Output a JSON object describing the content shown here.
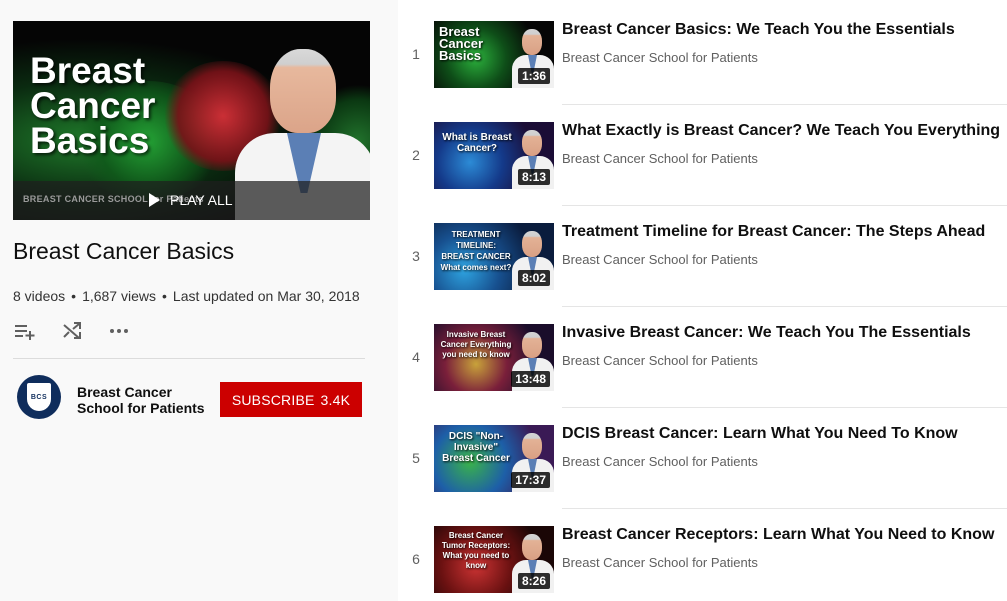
{
  "playlist": {
    "title": "Breast Cancer Basics",
    "hero_text": [
      "Breast",
      "Cancer",
      "Basics"
    ],
    "hero_brand": "BREAST CANCER SCHOOL for Patients",
    "play_all": "PLAY ALL",
    "videos_count": "8 videos",
    "views": "1,687 views",
    "updated": "Last updated on Mar 30, 2018",
    "sep": "•"
  },
  "owner": {
    "avatar_text": "BCS",
    "name": "Breast Cancer School for Patients",
    "subscribe_label": "SUBSCRIBE",
    "subscribers": "3.4K"
  },
  "colors": {
    "subscribe": "#cc0000",
    "background_sidebar": "#f9f9f9"
  },
  "videos": [
    {
      "index": "1",
      "title": "Breast Cancer Basics: We Teach You the Essentials",
      "channel": "Breast Cancer School for Patients",
      "duration": "1:36",
      "thumb_text": "Breast Cancer Basics"
    },
    {
      "index": "2",
      "title": "What Exactly is Breast Cancer? We Teach You Everything",
      "channel": "Breast Cancer School for Patients",
      "duration": "8:13",
      "thumb_text": "What is Breast Cancer?"
    },
    {
      "index": "3",
      "title": "Treatment Timeline for Breast Cancer: The Steps Ahead",
      "channel": "Breast Cancer School for Patients",
      "duration": "8:02",
      "thumb_text": "TREATMENT TIMELINE: BREAST CANCER What comes next?"
    },
    {
      "index": "4",
      "title": "Invasive Breast Cancer: We Teach You The Essentials",
      "channel": "Breast Cancer School for Patients",
      "duration": "13:48",
      "thumb_text": "Invasive Breast Cancer Everything you need to know"
    },
    {
      "index": "5",
      "title": "DCIS Breast Cancer: Learn What You Need To Know",
      "channel": "Breast Cancer School for Patients",
      "duration": "17:37",
      "thumb_text": "DCIS \"Non-Invasive\" Breast Cancer"
    },
    {
      "index": "6",
      "title": "Breast Cancer Receptors: Learn What You Need to Know",
      "channel": "Breast Cancer School for Patients",
      "duration": "8:26",
      "thumb_text": "Breast Cancer Tumor Receptors: What you need to know"
    }
  ]
}
